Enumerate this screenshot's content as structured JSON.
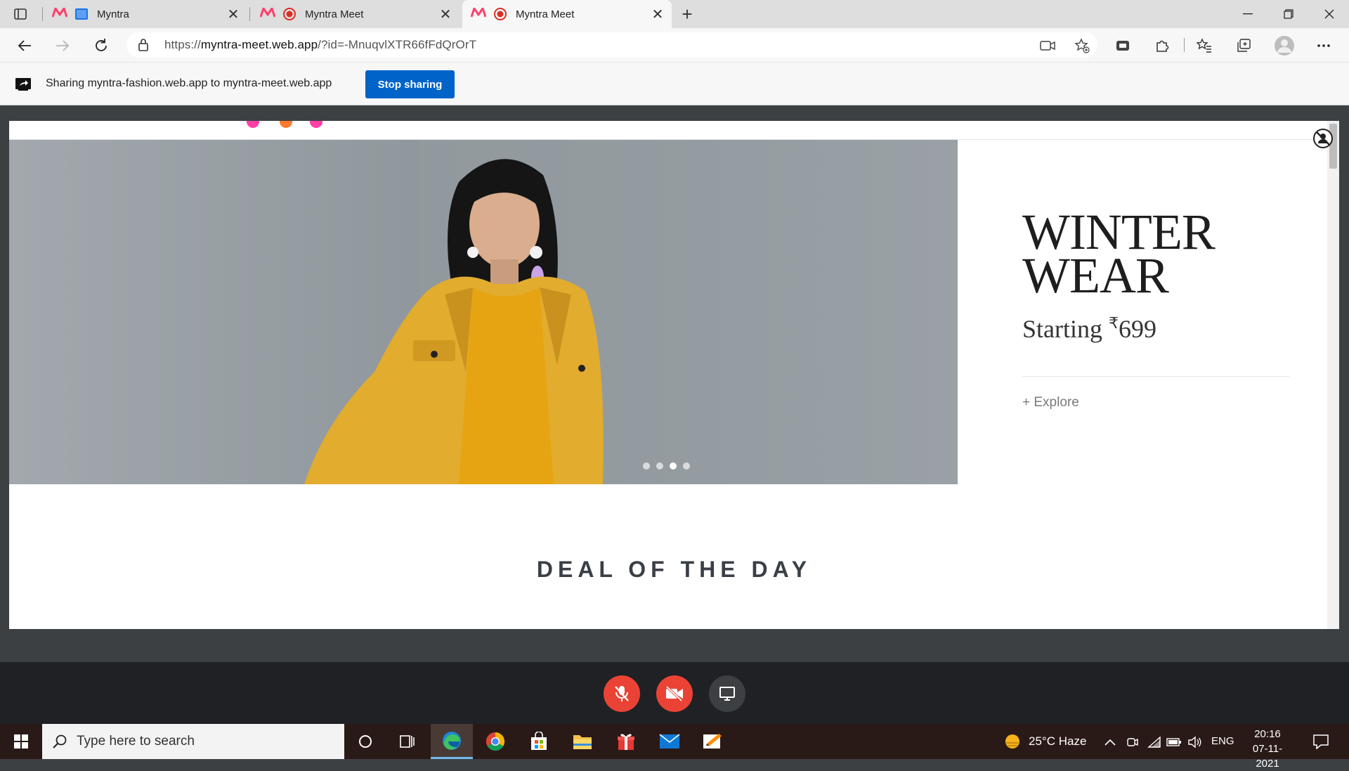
{
  "browser": {
    "tabs": [
      {
        "title": "Myntra",
        "active": false
      },
      {
        "title": "Myntra Meet",
        "active": false
      },
      {
        "title": "Myntra Meet",
        "active": true
      }
    ],
    "address": {
      "url_prefix": "https://",
      "url_host": "myntra-meet.web.app",
      "url_rest": "/?id=-MnuqvlXTR66fFdQrOrT"
    }
  },
  "share_bar": {
    "message": "Sharing myntra-fashion.web.app to myntra-meet.web.app",
    "stop_label": "Stop sharing"
  },
  "shared_page": {
    "promo": {
      "heading_line1": "WINTER",
      "heading_line2": "WEAR",
      "starting_text": "Starting",
      "currency": "₹",
      "price": "699",
      "explore_label": "+ Explore"
    },
    "carousel": {
      "count": 4,
      "active_index": 2
    },
    "section_title": "DEAL OF THE DAY"
  },
  "meet_controls": {
    "mic": "muted",
    "camera": "off",
    "screen_share": "active"
  },
  "taskbar": {
    "search_placeholder": "Type here to search",
    "weather": "25°C  Haze",
    "language": "ENG",
    "time": "20:16",
    "date": "07-11-2021"
  },
  "colors": {
    "myntra_accent": "#ff3f6c",
    "share_button": "#0063c7",
    "meet_red": "#ea4335",
    "meet_bg": "#3c4043"
  }
}
